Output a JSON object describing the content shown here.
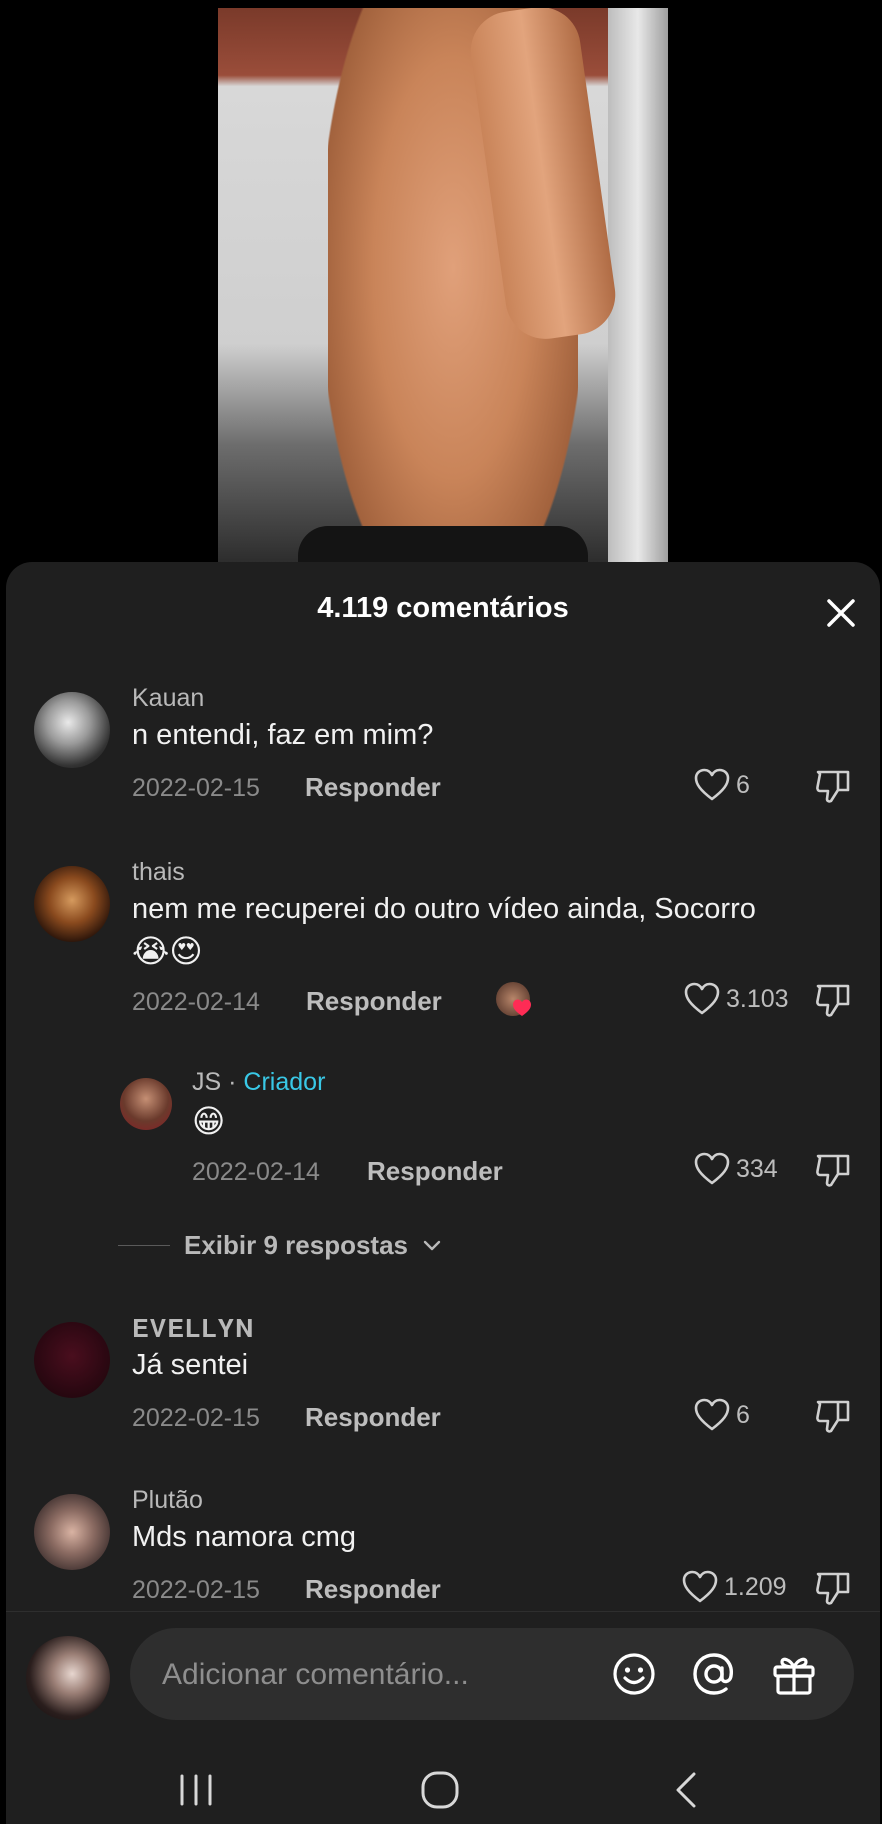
{
  "header": {
    "title": "4.119 comentários"
  },
  "comments": [
    {
      "username": "Kauan",
      "text": "n entendi, faz em mim?",
      "date": "2022-02-15",
      "reply_label": "Responder",
      "likes": "6"
    },
    {
      "username": "thais",
      "text": "nem me recuperei do outro vídeo ainda, Socorro",
      "emojis": "😭😍",
      "date": "2022-02-14",
      "reply_label": "Responder",
      "likes": "3.103",
      "reply": {
        "username": "JS",
        "separator": "·",
        "creator_label": "Criador",
        "text": "😁",
        "date": "2022-02-14",
        "reply_label": "Responder",
        "likes": "334"
      },
      "view_replies": "Exibir 9 respostas"
    },
    {
      "username": "𝐄𝐕𝐄𝐋𝐋𝐘𝐍",
      "text": "Já sentei",
      "date": "2022-02-15",
      "reply_label": "Responder",
      "likes": "6"
    },
    {
      "username": "Plutão",
      "text": "Mds namora cmg",
      "date": "2022-02-15",
      "reply_label": "Responder",
      "likes": "1.209"
    }
  ],
  "composer": {
    "placeholder": "Adicionar comentário..."
  },
  "colors": {
    "sheet_bg": "#1f1f1f",
    "creator_accent": "#39c8e6",
    "like_heart_accent": "#fe2c55"
  }
}
